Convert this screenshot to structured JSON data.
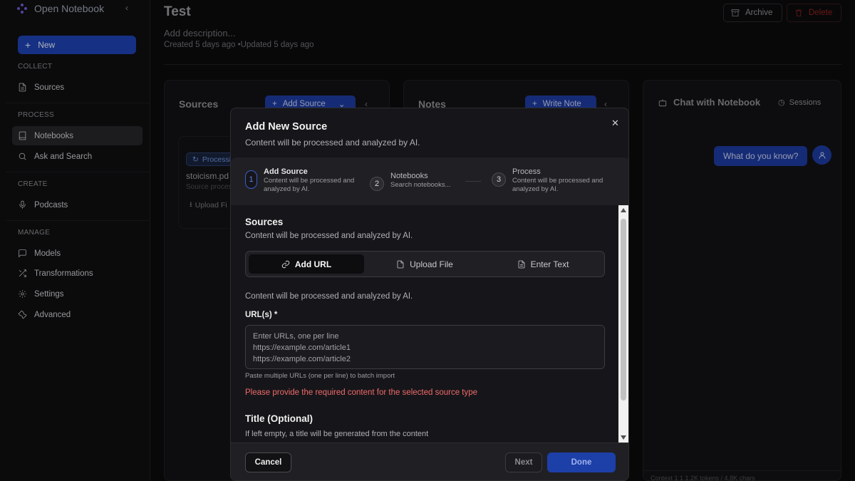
{
  "app": {
    "title": "Open Notebook"
  },
  "sidebar": {
    "new_label": "New",
    "sections": {
      "collect": "COLLECT",
      "process": "PROCESS",
      "create": "CREATE",
      "manage": "MANAGE"
    },
    "items": {
      "sources": "Sources",
      "notebooks": "Notebooks",
      "ask": "Ask and Search",
      "podcasts": "Podcasts",
      "models": "Models",
      "transformations": "Transformations",
      "settings": "Settings",
      "advanced": "Advanced"
    }
  },
  "header": {
    "title": "Test",
    "description_placeholder": "Add description...",
    "meta": "Created 5 days ago •Updated 5 days ago",
    "archive_label": "Archive",
    "delete_label": "Delete"
  },
  "sources_panel": {
    "title": "Sources",
    "add_label": "Add Source",
    "status_badge": "Processi",
    "source_name": "stoicism.pd",
    "source_sub": "Source proces",
    "upload_label": "Upload Fi"
  },
  "notes_panel": {
    "title": "Notes",
    "write_label": "Write Note"
  },
  "chat_panel": {
    "title": "Chat with Notebook",
    "sessions_label": "Sessions",
    "user_message": "What do you know?",
    "context_bar": "Context   1     1          1.2K tokens  /  4.8K chars"
  },
  "modal": {
    "title": "Add New Source",
    "subtitle": "Content will be processed and analyzed by AI.",
    "steps": [
      {
        "num": "1",
        "title": "Add Source",
        "desc": "Content will be processed and analyzed by AI."
      },
      {
        "num": "2",
        "title": "Notebooks",
        "desc": "Search notebooks..."
      },
      {
        "num": "3",
        "title": "Process",
        "desc": "Content will be processed and analyzed by AI."
      }
    ],
    "section_title": "Sources",
    "section_sub": "Content will be processed and analyzed by AI.",
    "tabs": {
      "url": "Add URL",
      "upload": "Upload File",
      "text": "Enter Text"
    },
    "body_note": "Content will be processed and analyzed by AI.",
    "url_label": "URL(s) *",
    "url_placeholder": "Enter URLs, one per line\nhttps://example.com/article1\nhttps://example.com/article2",
    "url_help": "Paste multiple URLs (one per line) to batch import",
    "url_error": "Please provide the required content for the selected source type",
    "title_label": "Title (Optional)",
    "title_sub": "If left empty, a title will be generated from the content",
    "buttons": {
      "cancel": "Cancel",
      "next": "Next",
      "done": "Done"
    }
  },
  "colors": {
    "accent": "#1e40af",
    "error": "#f06a6a",
    "background": "#0b0b0d"
  }
}
